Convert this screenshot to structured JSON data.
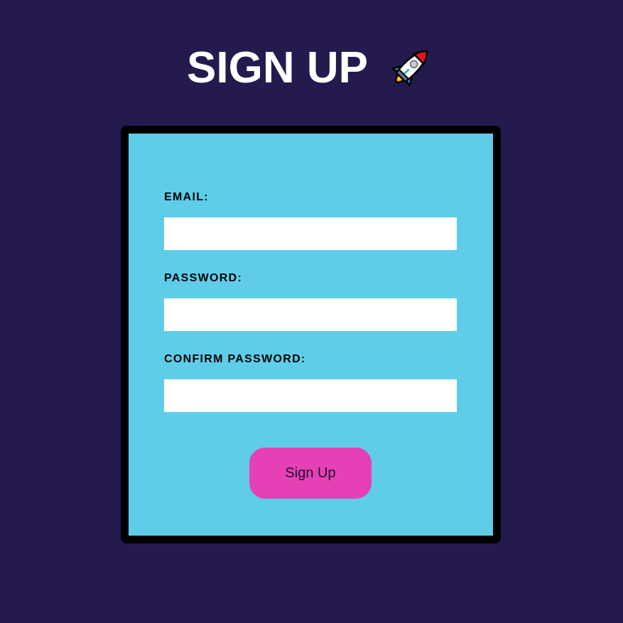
{
  "page": {
    "title": "SIGN UP",
    "title_icon": "rocket-icon"
  },
  "form": {
    "email_label": "EMAIL:",
    "email_value": "",
    "email_placeholder": "",
    "password_label": "PASSWORD:",
    "password_value": "",
    "password_placeholder": "",
    "confirm_password_label": "CONFIRM PASSWORD:",
    "confirm_password_value": "",
    "confirm_password_placeholder": "",
    "submit_label": "Sign Up"
  },
  "colors": {
    "background": "#251a4e",
    "card": "#5fcde8",
    "card_border": "#000000",
    "button": "#e540b5",
    "input": "#ffffff"
  }
}
